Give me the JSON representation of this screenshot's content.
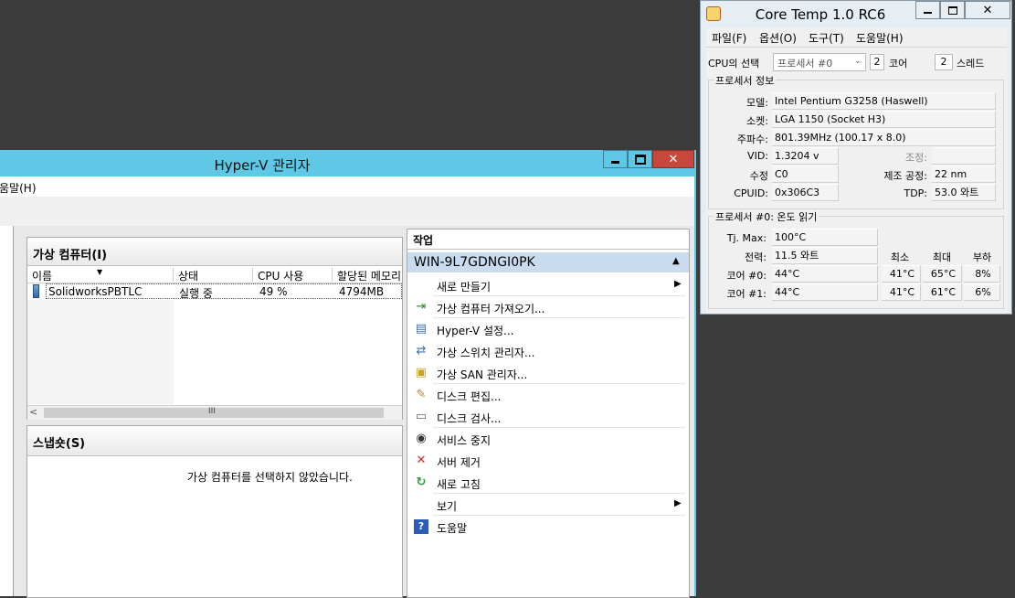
{
  "hyperv": {
    "title": "Hyper-V 관리자",
    "menu_help": "도움말(H)",
    "vm_panel": {
      "header": "가상 컴퓨터(I)",
      "columns": [
        "이름",
        "상태",
        "CPU 사용",
        "할당된 메모리"
      ],
      "rows": [
        {
          "name": "SolidworksPBTLC",
          "state": "실행 중",
          "cpu": "49 %",
          "memory": "4794MB"
        }
      ],
      "scroll_grip": "III"
    },
    "snapshot_panel": {
      "header": "스냅숏(S)",
      "empty_message": "가상 컴퓨터를 선택하지 않았습니다."
    },
    "actions": {
      "header": "작업",
      "server": "WIN-9L7GDNGI0PK",
      "items": [
        {
          "label": "새로 만들기",
          "icon": "none",
          "submenu": true
        },
        {
          "label": "가상 컴퓨터 가져오기...",
          "icon": "import-icon"
        },
        {
          "label": "Hyper-V 설정...",
          "icon": "settings-icon"
        },
        {
          "label": "가상 스위치 관리자...",
          "icon": "switch-icon"
        },
        {
          "label": "가상 SAN 관리자...",
          "icon": "san-icon"
        },
        {
          "label": "디스크 편집...",
          "icon": "edit-disk-icon"
        },
        {
          "label": "디스크 검사...",
          "icon": "inspect-disk-icon"
        },
        {
          "label": "서비스 중지",
          "icon": "stop-icon"
        },
        {
          "label": "서버 제거",
          "icon": "remove-icon"
        },
        {
          "label": "새로 고침",
          "icon": "refresh-icon"
        },
        {
          "label": "보기",
          "icon": "none",
          "submenu": true
        },
        {
          "label": "도움말",
          "icon": "help-icon"
        }
      ]
    }
  },
  "coretemp": {
    "title": "Core Temp 1.0 RC6",
    "menu": [
      "파일(F)",
      "옵션(O)",
      "도구(T)",
      "도움말(H)"
    ],
    "cpu_select_label": "CPU의 선택",
    "cpu_select_value": "프로세서 #0",
    "cores_count": "2",
    "cores_label": "코어",
    "threads_count": "2",
    "threads_label": "스레드",
    "proc_info_title": "프로세서 정보",
    "model_label": "모델:",
    "model": "Intel Pentium G3258 (Haswell)",
    "socket_label": "소켓:",
    "socket": "LGA 1150 (Socket H3)",
    "freq_label": "주파수:",
    "freq": "801.39MHz (100.17 x 8.0)",
    "vid_label": "VID:",
    "vid": "1.3204 v",
    "modulation_label": "조정:",
    "modulation": "",
    "revision_label": "수정",
    "revision": "C0",
    "lithography_label": "제조 공정:",
    "lithography": "22 nm",
    "cpuid_label": "CPUID:",
    "cpuid": "0x306C3",
    "tdp_label": "TDP:",
    "tdp": "53.0 와트",
    "temp_title": "프로세서 #0: 온도 읽기",
    "tjmax_label": "Tj. Max:",
    "tjmax": "100°C",
    "power_label": "전력:",
    "power": "11.5 와트",
    "min_label": "최소",
    "max_label": "최대",
    "load_label": "부하",
    "cores": [
      {
        "label": "코어 #0:",
        "temp": "44°C",
        "min": "41°C",
        "max": "65°C",
        "load": "8%"
      },
      {
        "label": "코어 #1:",
        "temp": "44°C",
        "min": "41°C",
        "max": "61°C",
        "load": "6%"
      }
    ]
  }
}
